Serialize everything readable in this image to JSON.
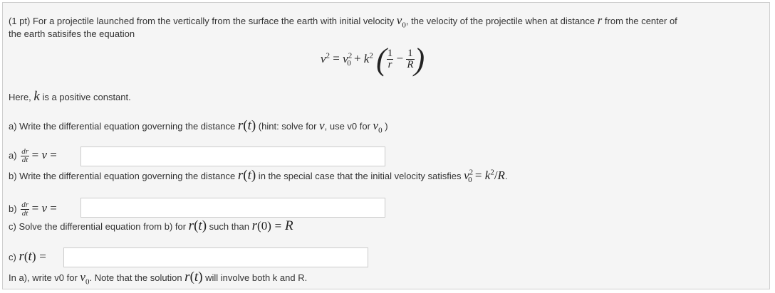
{
  "problem": {
    "intro_prefix": "(1 pt) For a projectile launched from the vertically from the surface the earth with initial velocity ",
    "intro_middle": ", the velocity of the projectile when at distance ",
    "intro_suffix": " from the center of",
    "intro_line2": "the earth satisifes the equation",
    "here_prefix": "Here, ",
    "here_suffix": " is a positive constant."
  },
  "part_a": {
    "question_prefix": "a) Write the differential equation governing the distance ",
    "question_hint_prefix": " (hint: solve for ",
    "question_hint_middle": ", use v0 for ",
    "question_hint_suffix": " )",
    "label": "a)",
    "answer_value": ""
  },
  "part_b": {
    "question_prefix": "b) Write the differential equation governing the distance ",
    "question_suffix": " in the special case that the initial velocity satisfies ",
    "label": "b)",
    "answer_value": ""
  },
  "part_c": {
    "question_prefix": "c) Solve the differential equation from b) for ",
    "question_middle": " such than ",
    "label": "c)",
    "answer_value": ""
  },
  "footer": {
    "note_prefix": "In a), write v0 for ",
    "note_middle": ". Note that the solution ",
    "note_suffix": " will involve both k and R."
  }
}
